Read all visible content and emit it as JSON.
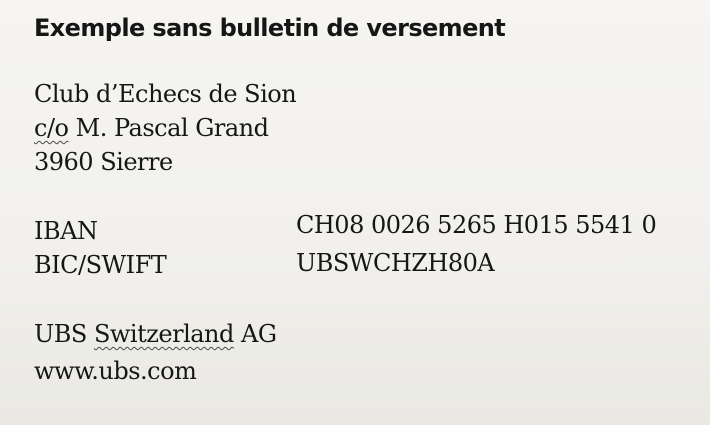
{
  "heading": "Exemple sans bulletin de versement",
  "address": {
    "name": "Club d’Echecs de Sion",
    "co_prefix": "c/o",
    "co_rest": " M. Pascal Grand",
    "city": "3960 Sierre"
  },
  "bank_details": {
    "iban_label": "IBAN",
    "iban_value": "CH08 0026 5265 H015 5541 0",
    "bic_label": "BIC/SWIFT",
    "bic_value": "UBSWCHZH80A"
  },
  "bank": {
    "name_prefix": "UBS ",
    "name_word": "Switzerland",
    "name_suffix": " AG",
    "website": "www.ubs.com"
  }
}
